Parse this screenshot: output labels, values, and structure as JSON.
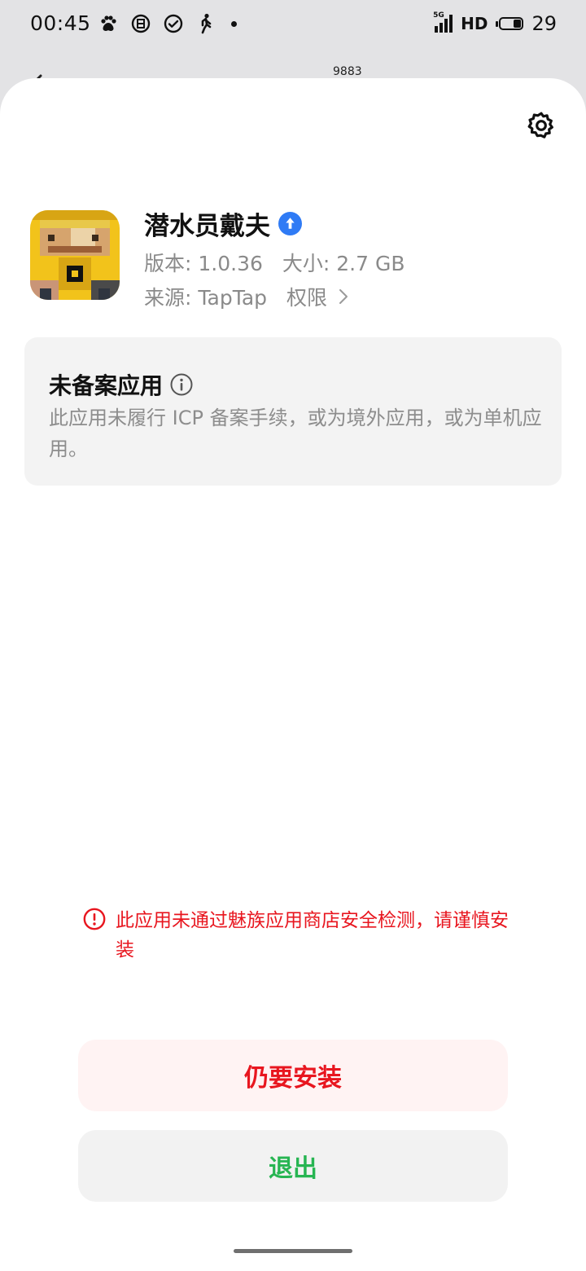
{
  "status_bar": {
    "time": "00:45",
    "network_label": "HD",
    "signal_type": "5G",
    "battery": "29",
    "left_icons": [
      "paw-icon",
      "e-icon",
      "check-circle-icon",
      "walking-icon",
      "dot-icon"
    ]
  },
  "behind_header": {
    "badge": "9883"
  },
  "app": {
    "name": "潜水员戴夫",
    "version": "版本: 1.0.36",
    "size": "大小: 2.7 GB",
    "source": "来源: TapTap",
    "permission_label": "权限"
  },
  "notice": {
    "title": "未备案应用",
    "body": "此应用未履行 ICP 备案手续，或为境外应用，或为单机应用。"
  },
  "warning": {
    "text": "此应用未通过魅族应用商店安全检测，请谨慎安装"
  },
  "buttons": {
    "install_anyway": "仍要安装",
    "exit": "退出"
  },
  "colors": {
    "danger": "#e8161f",
    "success": "#27b552",
    "badge_blue": "#2f7bf5"
  }
}
